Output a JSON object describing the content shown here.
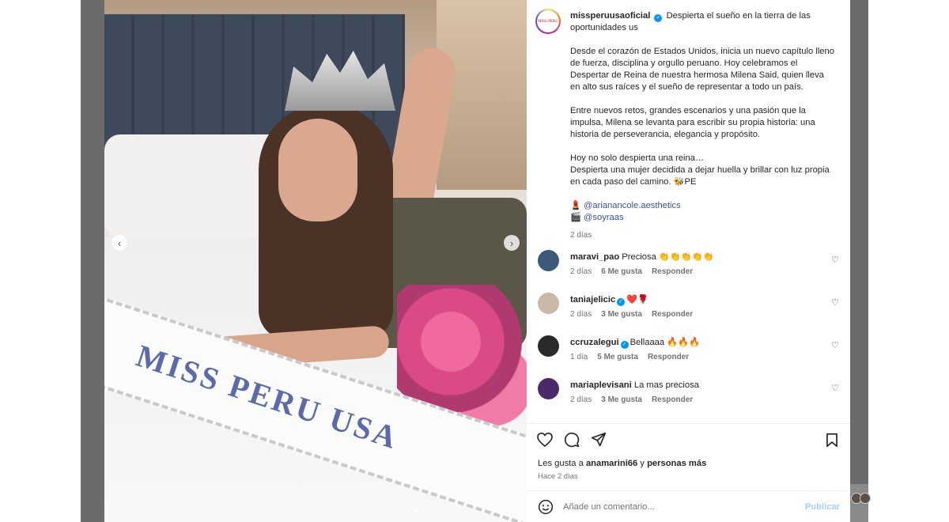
{
  "post": {
    "username": "missperuusaoficial",
    "caption_title": "Despierta el sueño en la tierra de las oportunidades us",
    "paragraphs": [
      "Desde el corazón de Estados Unidos, inicia un nuevo capítulo lleno de fuerza, disciplina y orgullo peruano. Hoy celebramos el Despertar de Reina de nuestra hermosa Milena Said, quien lleva en alto sus raíces y el sueño de representar a todo un país.",
      "Entre nuevos retos, grandes escenarios y una pasión que la impulsa, Milena se levanta para escribir su propia historia: una historia de perseverancia, elegancia y propósito.",
      "Hoy no solo despierta una reina…",
      "Despierta una mujer decidida a dejar huella y brillar con luz propia en cada paso del camino. 🐝PE"
    ],
    "credit_1_emoji": "💄",
    "credit_1": "@arianancole.aesthetics",
    "credit_2_emoji": "🎬",
    "credit_2": "@soyraas",
    "time": "2 días",
    "sash_text": "MISS PERU USA"
  },
  "comments": [
    {
      "user": "maravi_pao",
      "verified": false,
      "text": "Preciosa 👏👏👏👏👏",
      "time": "2 días",
      "likes": "6 Me gusta",
      "reply": "Responder",
      "avatar_color": "#3b5a7a"
    },
    {
      "user": "taniajelicic",
      "verified": true,
      "text": "❤️🌹",
      "time": "2 días",
      "likes": "3 Me gusta",
      "reply": "Responder",
      "avatar_color": "#c8b8a8"
    },
    {
      "user": "ccruzalegui",
      "verified": true,
      "text": "Bellaaaa 🔥🔥🔥",
      "time": "1 día",
      "likes": "5 Me gusta",
      "reply": "Responder",
      "avatar_color": "#2a2a2a"
    },
    {
      "user": "mariaplevisani",
      "verified": false,
      "text": "La mas preciosa",
      "time": "2 días",
      "likes": "3 Me gusta",
      "reply": "Responder",
      "avatar_color": "#4a2a6a"
    }
  ],
  "footer": {
    "likes_prefix": "Les gusta a ",
    "likes_user": "anamarini66",
    "likes_mid": " y ",
    "likes_suffix": "personas más",
    "posted": "Hace 2 días",
    "comment_placeholder": "Añade un comentario...",
    "publish_label": "Publicar"
  },
  "carousel": {
    "slides": 4,
    "active": 2
  },
  "icons": [
    "heart-icon",
    "comment-icon",
    "share-icon",
    "bookmark-icon",
    "emoji-icon",
    "chevron-left-icon",
    "chevron-right-icon",
    "verified-icon"
  ]
}
